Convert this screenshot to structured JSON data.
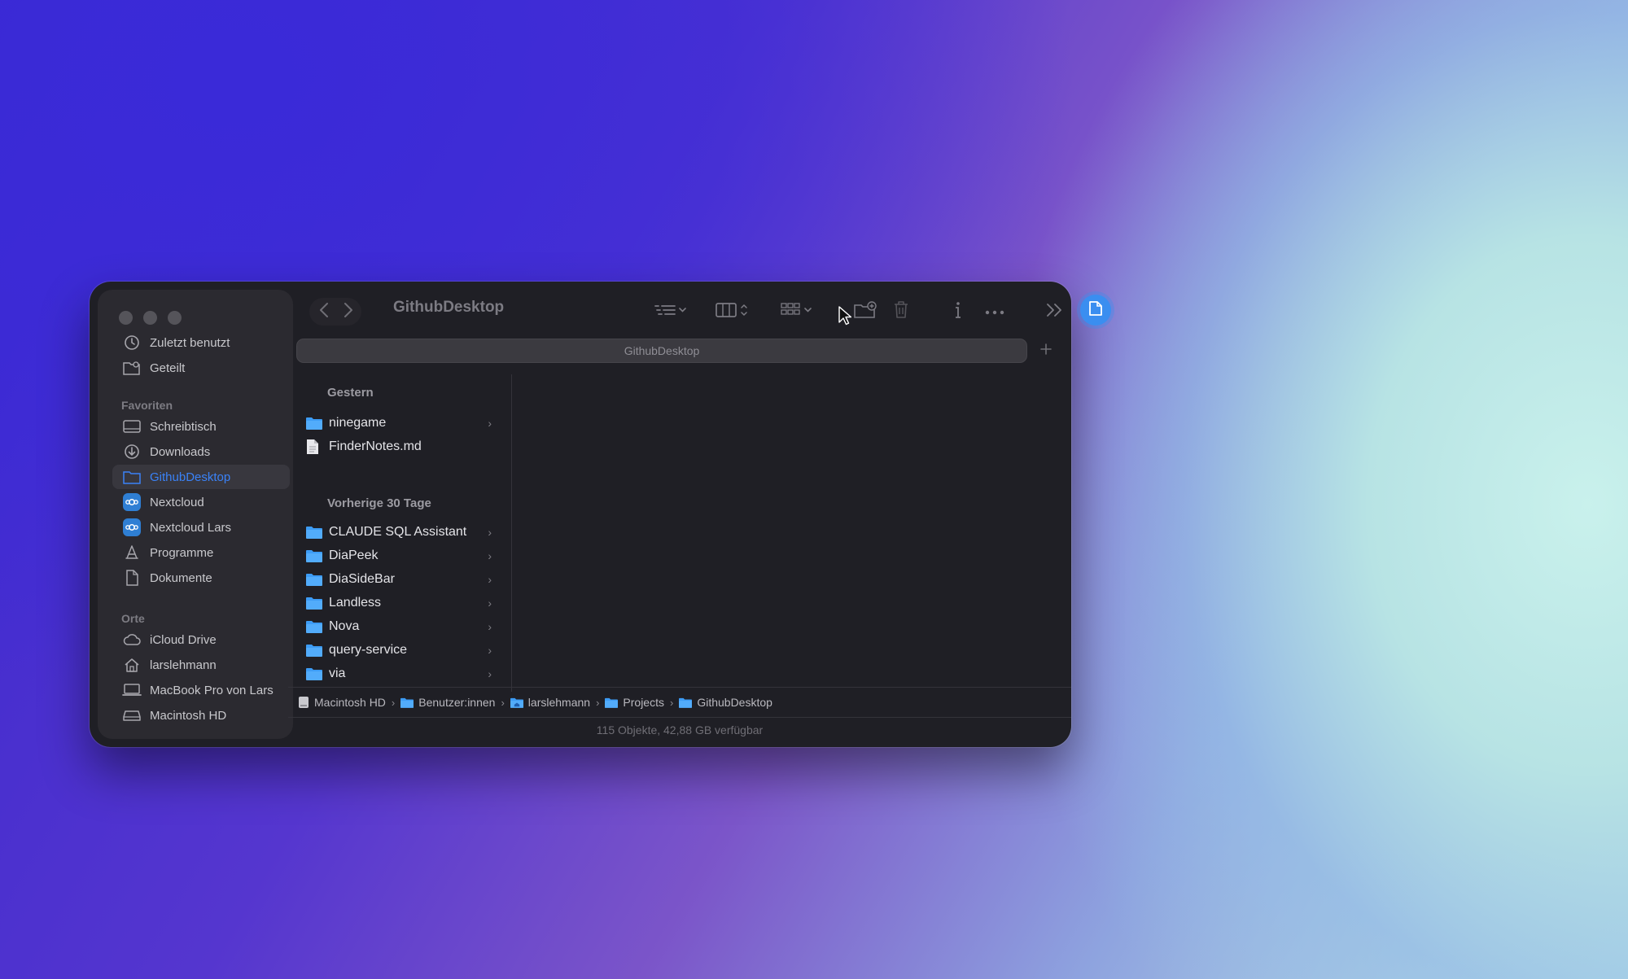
{
  "window": {
    "title": "GithubDesktop",
    "tab_title": "GithubDesktop"
  },
  "sidebar": {
    "top_items": [
      {
        "label": "Zuletzt benutzt",
        "icon": "clock-icon"
      },
      {
        "label": "Geteilt",
        "icon": "shared-folder-icon"
      }
    ],
    "favorites_title": "Favoriten",
    "favorites": [
      {
        "label": "Schreibtisch",
        "icon": "desktop-icon"
      },
      {
        "label": "Downloads",
        "icon": "download-icon"
      },
      {
        "label": "GithubDesktop",
        "icon": "folder-icon",
        "selected": true
      },
      {
        "label": "Nextcloud",
        "icon": "nextcloud-icon"
      },
      {
        "label": "Nextcloud Lars",
        "icon": "nextcloud-icon"
      },
      {
        "label": "Programme",
        "icon": "apps-icon"
      },
      {
        "label": "Dokumente",
        "icon": "document-icon"
      }
    ],
    "locations_title": "Orte",
    "locations": [
      {
        "label": "iCloud Drive",
        "icon": "cloud-icon"
      },
      {
        "label": "larslehmann",
        "icon": "home-icon"
      },
      {
        "label": "MacBook Pro von Lars",
        "icon": "laptop-icon"
      },
      {
        "label": "Macintosh HD",
        "icon": "disk-icon"
      }
    ]
  },
  "content": {
    "group_yesterday": "Gestern",
    "yesterday_items": [
      {
        "name": "ninegame",
        "type": "folder"
      },
      {
        "name": "FinderNotes.md",
        "type": "file"
      }
    ],
    "group_previous": "Vorherige 30 Tage",
    "previous_items": [
      {
        "name": "CLAUDE SQL Assistant",
        "type": "folder"
      },
      {
        "name": "DiaPeek",
        "type": "folder"
      },
      {
        "name": "DiaSideBar",
        "type": "folder"
      },
      {
        "name": "Landless",
        "type": "folder"
      },
      {
        "name": "Nova",
        "type": "folder"
      },
      {
        "name": "query-service",
        "type": "folder"
      },
      {
        "name": "via",
        "type": "folder"
      }
    ]
  },
  "pathbar": [
    {
      "label": "Macintosh HD",
      "icon": "disk-icon"
    },
    {
      "label": "Benutzer:innen",
      "icon": "folder-icon"
    },
    {
      "label": "larslehmann",
      "icon": "home-folder-icon"
    },
    {
      "label": "Projects",
      "icon": "folder-icon"
    },
    {
      "label": "GithubDesktop",
      "icon": "folder-icon"
    }
  ],
  "status": "115 Objekte, 42,88 GB verfügbar",
  "colors": {
    "accent": "#3a82f7",
    "folder": "#3d9cf5",
    "window_bg": "#1f1f25",
    "sidebar_bg": "#2b2a30"
  }
}
